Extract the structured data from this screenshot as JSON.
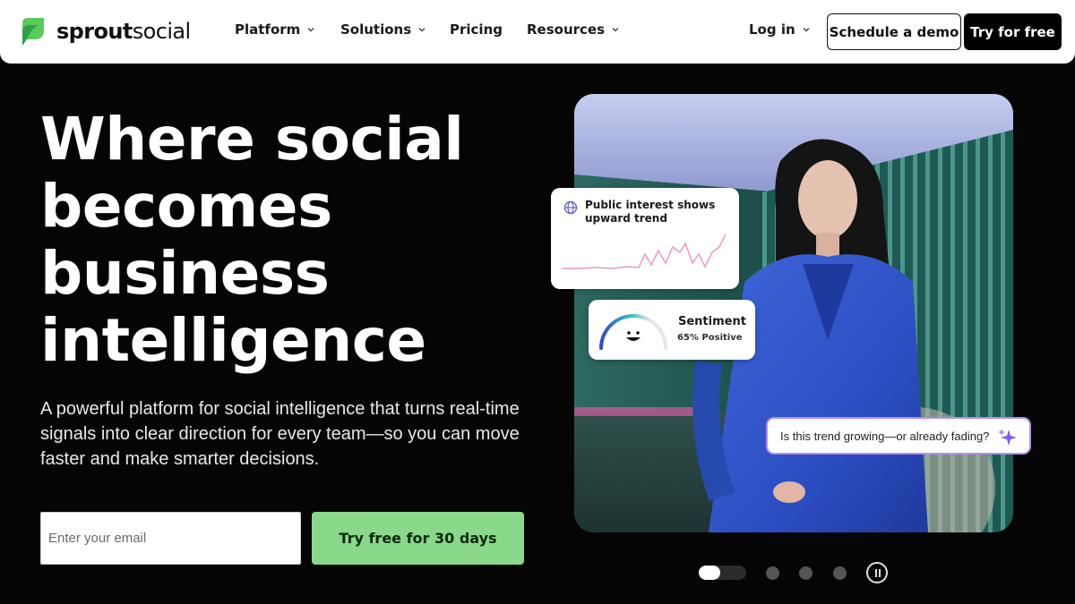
{
  "nav": {
    "logo_bold": "sprout",
    "logo_light": "social",
    "items": [
      {
        "label": "Platform",
        "dropdown": true
      },
      {
        "label": "Solutions",
        "dropdown": true
      },
      {
        "label": "Pricing",
        "dropdown": false
      },
      {
        "label": "Resources",
        "dropdown": true
      }
    ],
    "login_label": "Log in",
    "demo_label": "Schedule a demo",
    "try_label": "Try for free"
  },
  "hero": {
    "headline": "Where social becomes business intelligence",
    "subtext": "A powerful platform for social intelligence that turns real-time signals into clear direction for every team—so you can move faster and make smarter decisions.",
    "email_placeholder": "Enter your email",
    "cta_label": "Try free for 30 days"
  },
  "cards": {
    "trend_title": "Public interest shows upward trend",
    "sentiment_title": "Sentiment",
    "sentiment_value": "65% Positive",
    "sentiment_level": 0.65,
    "question": "Is this trend growing—or already fading?"
  },
  "carousel": {
    "slide_count": 4,
    "active_index": 0
  },
  "colors": {
    "cta_green": "#8ad98a",
    "logo_green": "#59cb59",
    "accent_purple": "#b58cf0",
    "sparkline_pink": "#e79bc0",
    "background": "#050505"
  },
  "icons": [
    "logo-leaf-icon",
    "chevron-down-icon",
    "globe-icon",
    "smile-icon",
    "sparkle-icon",
    "pause-icon"
  ]
}
